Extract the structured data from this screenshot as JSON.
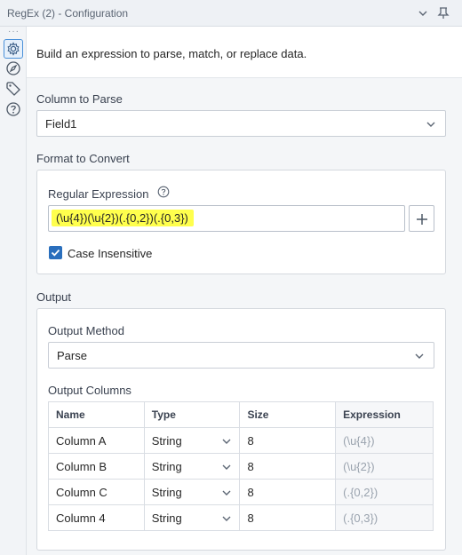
{
  "window": {
    "title": "RegEx (2) - Configuration"
  },
  "rail": {
    "dots": "···"
  },
  "intro": "Build an expression to parse, match, or replace data.",
  "column_to_parse": {
    "label": "Column to Parse",
    "value": "Field1"
  },
  "format": {
    "label": "Format to Convert",
    "regex_label": "Regular Expression",
    "regex_value": "(\\u{4})(\\u{2})(.{0,2})(.{0,3})",
    "highlight_color": "#ffff4d",
    "case_insensitive_label": "Case Insensitive",
    "case_insensitive_checked": true
  },
  "output": {
    "label": "Output",
    "method_label": "Output Method",
    "method_value": "Parse",
    "columns_label": "Output Columns",
    "headers": [
      "Name",
      "Type",
      "Size",
      "Expression"
    ],
    "rows": [
      {
        "name": "Column A",
        "type": "String",
        "size": "8",
        "expression": "(\\u{4})"
      },
      {
        "name": "Column B",
        "type": "String",
        "size": "8",
        "expression": "(\\u{2})"
      },
      {
        "name": "Column C",
        "type": "String",
        "size": "8",
        "expression": "(.{0,2})"
      },
      {
        "name": "Column 4",
        "type": "String",
        "size": "8",
        "expression": "(.{0,3})"
      }
    ]
  },
  "colors": {
    "accent": "#2a6fbd",
    "checkbox": "#2a6fbd"
  },
  "icons": [
    "chevron-down-icon",
    "pin-icon",
    "gear-icon",
    "compass-icon",
    "tag-icon",
    "help-icon",
    "plus-icon",
    "check-icon"
  ]
}
